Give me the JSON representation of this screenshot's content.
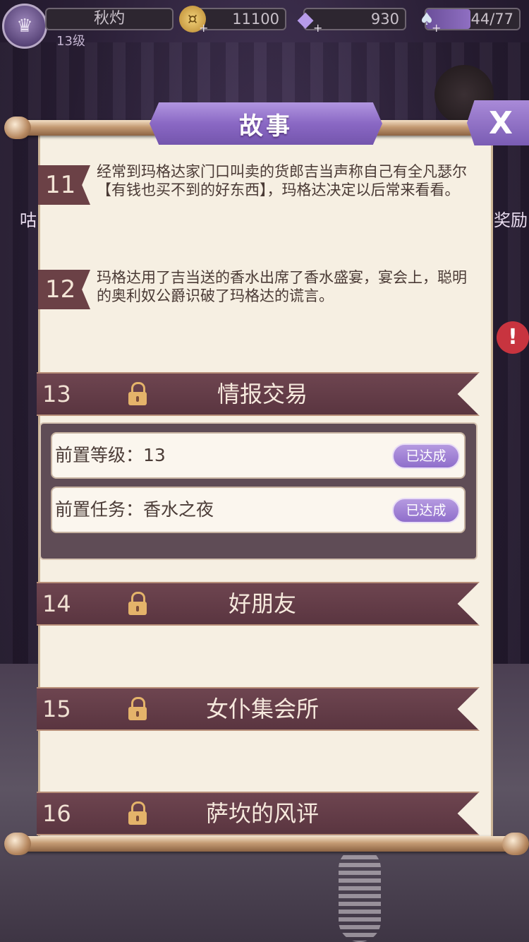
{
  "topbar": {
    "player_name": "秋灼",
    "level": "13级",
    "gold": "11100",
    "diamonds": "930",
    "stamina": "44/77"
  },
  "panel": {
    "title": "故事",
    "close_label": "X"
  },
  "stories": [
    {
      "number": "11",
      "text": "经常到玛格达家门口叫卖的货郎吉当声称自己有全凡瑟尔【有钱也买不到的好东西】，玛格达决定以后常来看看。"
    },
    {
      "number": "12",
      "text": "玛格达用了吉当送的香水出席了香水盛宴，宴会上，聪明的奥利奴公爵识破了玛格达的谎言。"
    }
  ],
  "chapters": [
    {
      "number": "13",
      "title": "情报交易"
    },
    {
      "number": "14",
      "title": "好朋友"
    },
    {
      "number": "15",
      "title": "女仆集会所"
    },
    {
      "number": "16",
      "title": "萨坎的风评"
    }
  ],
  "requirements": [
    {
      "label": "前置等级：13",
      "status": "已达成"
    },
    {
      "label": "前置任务：香水之夜",
      "status": "已达成"
    }
  ],
  "side_labels": {
    "left": "咕",
    "right": "奖励"
  }
}
